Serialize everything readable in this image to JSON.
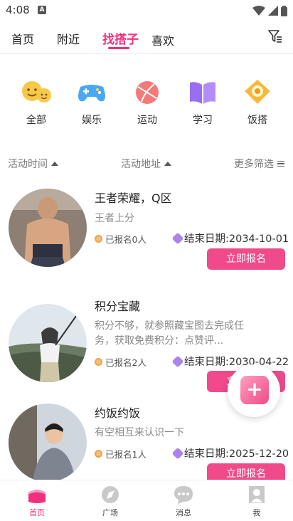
{
  "status_bar": {
    "time": "4:08",
    "notification": "A"
  },
  "top_tabs": [
    {
      "label": "首页",
      "active": false
    },
    {
      "label": "附近",
      "active": false
    },
    {
      "label": "找搭子",
      "active": true
    },
    {
      "label": "喜欢",
      "active": false
    }
  ],
  "categories": [
    {
      "label": "全部",
      "icon": "smile-faces-icon"
    },
    {
      "label": "娱乐",
      "icon": "gamepad-icon"
    },
    {
      "label": "运动",
      "icon": "ball-icon"
    },
    {
      "label": "学习",
      "icon": "book-icon"
    },
    {
      "label": "饭搭",
      "icon": "food-icon"
    }
  ],
  "filter_bar": {
    "time": "活动时间",
    "location": "活动地址",
    "more": "更多筛选"
  },
  "activities": [
    {
      "title": "王者荣耀，Q区",
      "desc": "王者上分",
      "count": "已报名0人",
      "end": "结束日期:2034-10-01",
      "button": "立即报名"
    },
    {
      "title": "积分宝藏",
      "desc": "积分不够，就参照藏宝图去完成任务，获取免费积分：点赞评...",
      "count": "已报名2人",
      "end": "结束日期:2030-04-22",
      "button": "立即报名"
    },
    {
      "title": "约饭约饭",
      "desc": "有空相互来认识一下",
      "count": "已报名1人",
      "end": "结束日期:2025-12-20",
      "button": "立即报名"
    }
  ],
  "fab": {
    "icon": "plus-icon"
  },
  "bottom_nav": [
    {
      "label": "首页",
      "active": true
    },
    {
      "label": "广场",
      "active": false
    },
    {
      "label": "消息",
      "active": false
    },
    {
      "label": "我",
      "active": false
    }
  ],
  "colors": {
    "accent": "#f0307d",
    "button": "#f04a8a"
  }
}
